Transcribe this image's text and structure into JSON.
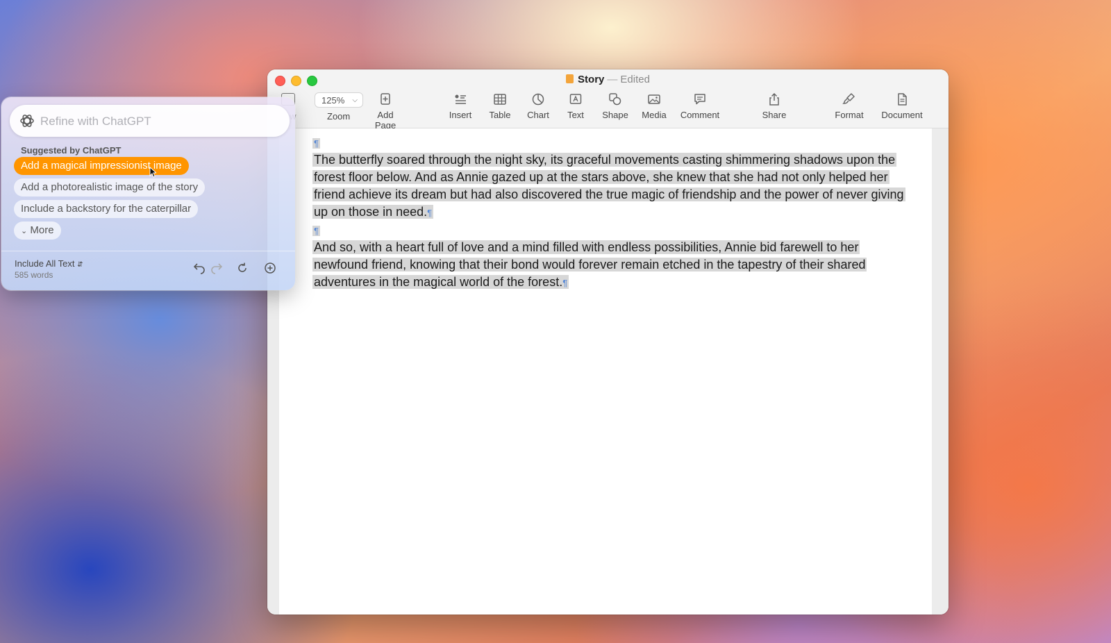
{
  "window": {
    "title": "Story",
    "title_separator": "—",
    "status": "Edited"
  },
  "toolbar": {
    "view_fragment": "w",
    "zoom_value": "125%",
    "zoom_label": "Zoom",
    "add_page": "Add Page",
    "insert": "Insert",
    "table": "Table",
    "chart": "Chart",
    "text": "Text",
    "shape": "Shape",
    "media": "Media",
    "comment": "Comment",
    "share": "Share",
    "format": "Format",
    "document": "Document"
  },
  "document": {
    "pilcrow": "¶",
    "paragraph1": "The butterfly soared through the night sky, its graceful movements casting shimmering shadows upon the forest floor below. And as Annie gazed up at the stars above, she knew that she had not only helped her friend achieve its dream but had also discovered the true magic of friendship and the power of never giving up on those in need.",
    "paragraph2": "And so, with a heart full of love and a mind filled with endless possibilities, Annie bid farewell to her newfound friend, knowing that their bond would forever remain etched in the tapestry of their shared adventures in the magical world of the forest."
  },
  "chatgpt_panel": {
    "refine_placeholder": "Refine with ChatGPT",
    "suggested_title": "Suggested by ChatGPT",
    "suggestions": [
      "Add a magical impressionist image",
      "Add a photorealistic image of the story",
      "Include a backstory for the caterpillar"
    ],
    "more_label": "More",
    "include_label": "Include All Text",
    "word_count": "585 words"
  },
  "colors": {
    "accent_orange": "#ff9500",
    "pilcrow_blue": "#5a8ad6",
    "selection_gray": "#d7d7d7"
  }
}
